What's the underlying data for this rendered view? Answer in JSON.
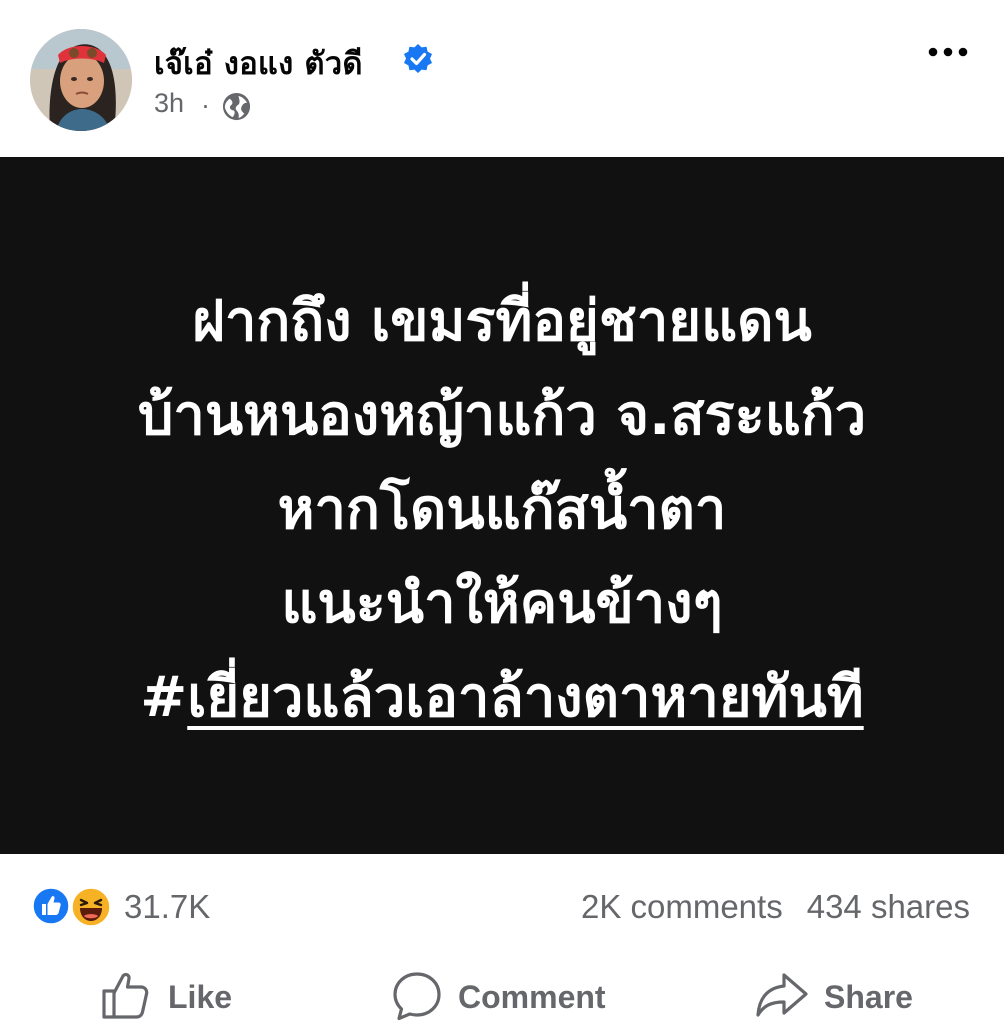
{
  "post": {
    "author": "เจ๊เอ๋ งอแง ตัวดี",
    "time": "3h",
    "separator": "·",
    "lines": [
      "ฝากถึง  เขมรที่อยู่ชายแดน",
      "บ้านหนองหญ้าแก้ว จ.สระแก้ว",
      "หากโดนแก๊สน้ำตา",
      "แนะนำให้คนข้างๆ"
    ],
    "hashtag_prefix": "#",
    "hashtag": "เยี่ยวแล้วเอาล้างตาหายทันที"
  },
  "stats": {
    "reaction_count": "31.7K",
    "comments": "2K comments",
    "shares": "434 shares"
  },
  "actions": {
    "like": "Like",
    "comment": "Comment",
    "share": "Share"
  },
  "colors": {
    "accent": "#1877f2",
    "muted": "#65676b",
    "post_bg": "#111111",
    "haha": "#f7b125"
  },
  "icons": [
    "verified-badge-icon",
    "globe-icon",
    "more-options-icon",
    "like-reaction-icon",
    "haha-reaction-icon",
    "thumbs-up-icon",
    "comment-bubble-icon",
    "share-arrow-icon"
  ]
}
